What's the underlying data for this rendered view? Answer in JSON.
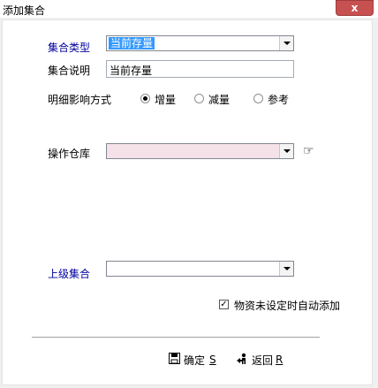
{
  "window": {
    "title": "添加集合",
    "close_label": "x"
  },
  "form": {
    "type_label": "集合类型",
    "type_value": "当前存量",
    "desc_label": "集合说明",
    "desc_value": "当前存量",
    "mode_label": "明细影响方式",
    "mode_options": [
      {
        "label": "增量",
        "checked": true
      },
      {
        "label": "减量",
        "checked": false
      },
      {
        "label": "参考",
        "checked": false
      }
    ],
    "warehouse_label": "操作仓库",
    "warehouse_value": "",
    "warehouse_icon": "pointing-hand-icon",
    "parent_label": "上级集合",
    "parent_value": "",
    "auto_add_label": "物资未设定时自动添加",
    "auto_add_checked": true
  },
  "buttons": {
    "ok_label": "确定",
    "ok_key": "S",
    "back_label": "返回",
    "back_key": "R"
  },
  "colors": {
    "accent_label": "#0000a0",
    "selection": "#3399ff",
    "warehouse_bg": "#f5e1e8",
    "close_btn": "#c75050"
  }
}
